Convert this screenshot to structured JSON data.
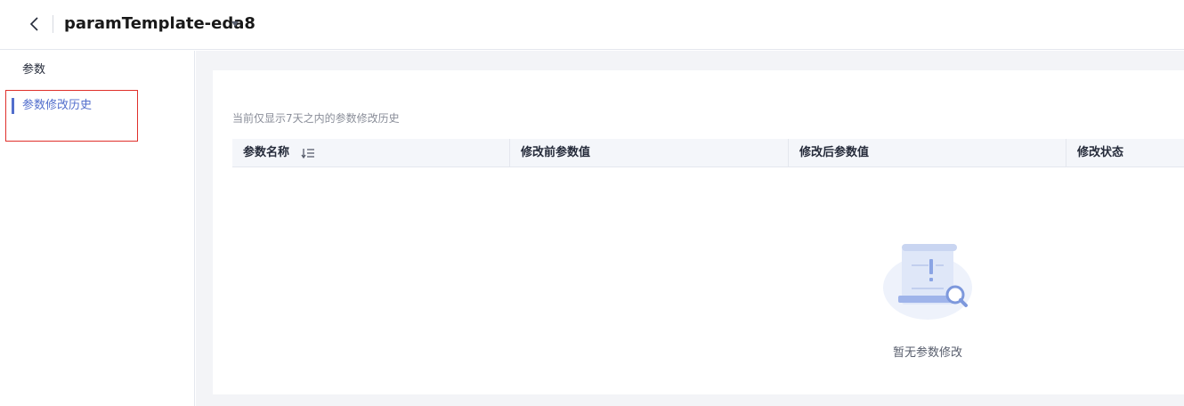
{
  "header": {
    "title": "paramTemplate-eda8"
  },
  "sidebar": {
    "items": [
      {
        "label": "参数"
      },
      {
        "label": "参数修改历史"
      }
    ]
  },
  "main": {
    "hint": "当前仅显示7天之内的参数修改历史",
    "table": {
      "columns": [
        {
          "label": "参数名称"
        },
        {
          "label": "修改前参数值"
        },
        {
          "label": "修改后参数值"
        },
        {
          "label": "修改状态"
        }
      ]
    },
    "empty_text": "暂无参数修改"
  },
  "colors": {
    "accent": "#526ecc",
    "highlight": "#e0302b",
    "content_bg": "#f3f4f7"
  }
}
